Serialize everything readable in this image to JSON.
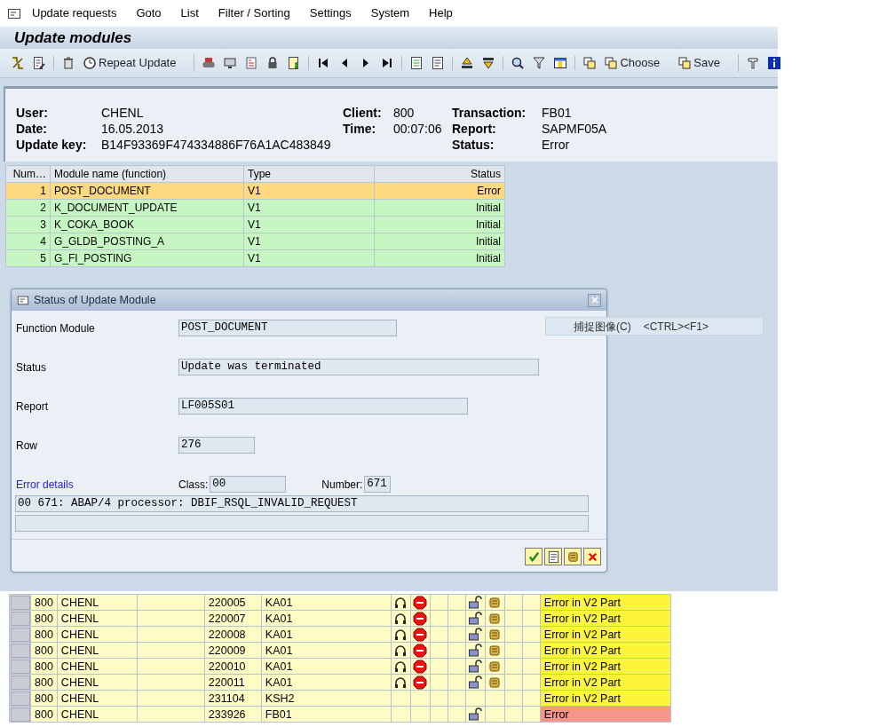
{
  "menu": [
    "Update requests",
    "Goto",
    "List",
    "Filter / Sorting",
    "Settings",
    "System",
    "Help"
  ],
  "title": "Update modules",
  "toolbar": {
    "groups": [
      {
        "buttons": [
          {
            "kind": "icon"
          },
          {
            "kind": "icon"
          }
        ]
      },
      {
        "buttons": [
          {
            "kind": "icon"
          },
          {
            "kind": "labeled",
            "label": "Repeat Update"
          }
        ]
      },
      {
        "buttons": [
          {
            "kind": "icon"
          },
          {
            "kind": "icon"
          },
          {
            "kind": "icon"
          },
          {
            "kind": "icon"
          },
          {
            "kind": "icon"
          }
        ]
      },
      {
        "buttons": [
          {
            "kind": "icon"
          },
          {
            "kind": "icon"
          },
          {
            "kind": "icon"
          },
          {
            "kind": "icon"
          }
        ]
      },
      {
        "buttons": [
          {
            "kind": "icon"
          },
          {
            "kind": "icon"
          }
        ]
      },
      {
        "buttons": [
          {
            "kind": "icon"
          },
          {
            "kind": "icon"
          }
        ]
      },
      {
        "buttons": [
          {
            "kind": "icon"
          },
          {
            "kind": "icon"
          },
          {
            "kind": "icon"
          }
        ]
      },
      {
        "buttons": [
          {
            "kind": "icon"
          },
          {
            "kind": "labeled",
            "label": "Choose"
          },
          {
            "kind": "labeled",
            "label": "Save"
          }
        ]
      },
      {
        "buttons": [
          {
            "kind": "icon"
          },
          {
            "kind": "icon"
          }
        ]
      }
    ]
  },
  "header": {
    "columns": [
      [
        {
          "label": "User:",
          "value": "CHENL"
        },
        {
          "label": "Date:",
          "value": "16.05.2013"
        },
        {
          "label": "Update key:",
          "value": "B14F93369F474334886F76A1AC483849"
        }
      ],
      [
        {
          "label": "Client:",
          "value": "800"
        },
        {
          "label": "Time:",
          "value": "00:07:06"
        }
      ],
      [
        {
          "label": "Transaction:",
          "value": "FB01"
        },
        {
          "label": "Report:",
          "value": "SAPMF05A"
        },
        {
          "label": "Status:",
          "value": "Error"
        }
      ]
    ]
  },
  "modules": {
    "columns": [
      "Num…",
      "Module name (function)",
      "Type",
      "Status"
    ],
    "rows": [
      {
        "number": "1",
        "name": "POST_DOCUMENT",
        "type": "V1",
        "status": "Error",
        "selected": true
      },
      {
        "number": "2",
        "name": "K_DOCUMENT_UPDATE",
        "type": "V1",
        "status": "Initial",
        "selected": false
      },
      {
        "number": "3",
        "name": "K_COKA_BOOK",
        "type": "V1",
        "status": "Initial",
        "selected": false
      },
      {
        "number": "4",
        "name": "G_GLDB_POSTING_A",
        "type": "V1",
        "status": "Initial",
        "selected": false
      },
      {
        "number": "5",
        "name": "G_FI_POSTING",
        "type": "V1",
        "status": "Initial",
        "selected": false
      }
    ]
  },
  "dialog": {
    "title": "Status of Update Module",
    "fields": [
      {
        "label": "Function Module",
        "value": "POST_DOCUMENT"
      },
      {
        "label": "Status",
        "value": "Update was terminated"
      },
      {
        "label": "Report",
        "value": "LF005S01"
      },
      {
        "label": "Row",
        "value": "276"
      }
    ],
    "error_details": {
      "link": "Error details",
      "class_label": "Class:",
      "class_value": "00",
      "number_label": "Number:",
      "number_value": "671",
      "lines": [
        "00 671: ABAP/4 processor: DBIF_RSQL_INVALID_REQUEST"
      ]
    },
    "buttons": [
      {
        "kind": "confirm"
      },
      {
        "kind": "document"
      },
      {
        "kind": "log"
      },
      {
        "kind": "cancel"
      }
    ]
  },
  "context_menu": {
    "label": "捕捉图像(C)",
    "shortcut": "<CTRL><F1>"
  },
  "background_list": {
    "rows": [
      {
        "client": "800",
        "user": "CHENL",
        "number": "220005",
        "tcode": "KA01",
        "status": "Error in V2 Part",
        "color": "#fcf53c",
        "repeat_icon": true,
        "stop_icon": true,
        "lock_icon": true,
        "log_icon": true
      },
      {
        "client": "800",
        "user": "CHENL",
        "number": "220007",
        "tcode": "KA01",
        "status": "Error in V2 Part",
        "color": "#fcf53c",
        "repeat_icon": true,
        "stop_icon": true,
        "lock_icon": true,
        "log_icon": true
      },
      {
        "client": "800",
        "user": "CHENL",
        "number": "220008",
        "tcode": "KA01",
        "status": "Error in V2 Part",
        "color": "#fcf53c",
        "repeat_icon": true,
        "stop_icon": true,
        "lock_icon": true,
        "log_icon": true
      },
      {
        "client": "800",
        "user": "CHENL",
        "number": "220009",
        "tcode": "KA01",
        "status": "Error in V2 Part",
        "color": "#fcf53c",
        "repeat_icon": true,
        "stop_icon": true,
        "lock_icon": true,
        "log_icon": true
      },
      {
        "client": "800",
        "user": "CHENL",
        "number": "220010",
        "tcode": "KA01",
        "status": "Error in V2 Part",
        "color": "#fcf53c",
        "repeat_icon": true,
        "stop_icon": true,
        "lock_icon": true,
        "log_icon": true
      },
      {
        "client": "800",
        "user": "CHENL",
        "number": "220011",
        "tcode": "KA01",
        "status": "Error in V2 Part",
        "color": "#fcf53c",
        "repeat_icon": true,
        "stop_icon": true,
        "lock_icon": true,
        "log_icon": true
      },
      {
        "client": "800",
        "user": "CHENL",
        "number": "231104",
        "tcode": "KSH2",
        "status": "Error in V2 Part",
        "color": "#fcf53c",
        "repeat_icon": false,
        "stop_icon": false,
        "lock_icon": false,
        "log_icon": false
      },
      {
        "client": "800",
        "user": "CHENL",
        "number": "233926",
        "tcode": "FB01",
        "status": "Error",
        "color": "#f7958a",
        "repeat_icon": false,
        "stop_icon": false,
        "lock_icon": true,
        "log_icon": false
      }
    ]
  }
}
